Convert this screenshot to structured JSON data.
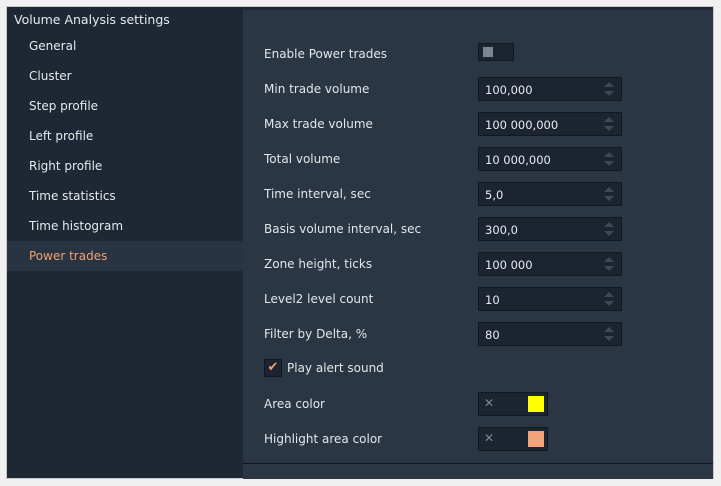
{
  "window": {
    "title": "Volume Analysis settings",
    "close_glyph": "✕"
  },
  "sidebar": {
    "items": [
      {
        "label": "General",
        "active": false
      },
      {
        "label": "Cluster",
        "active": false
      },
      {
        "label": "Step profile",
        "active": false
      },
      {
        "label": "Left profile",
        "active": false
      },
      {
        "label": "Right profile",
        "active": false
      },
      {
        "label": "Time statistics",
        "active": false
      },
      {
        "label": "Time histogram",
        "active": false
      },
      {
        "label": "Power trades",
        "active": true
      }
    ]
  },
  "form": {
    "enable_power_trades": {
      "label": "Enable Power trades",
      "enabled": false
    },
    "min_trade_volume": {
      "label": "Min trade volume",
      "value": "100,000"
    },
    "max_trade_volume": {
      "label": "Max trade volume",
      "value": "100 000,000"
    },
    "total_volume": {
      "label": "Total volume",
      "value": "10 000,000"
    },
    "time_interval": {
      "label": "Time interval, sec",
      "value": "5,0"
    },
    "basis_volume_interval": {
      "label": "Basis volume interval, sec",
      "value": "300,0"
    },
    "zone_height": {
      "label": "Zone height, ticks",
      "value": "100 000"
    },
    "level2_count": {
      "label": "Level2 level count",
      "value": "10"
    },
    "filter_by_delta": {
      "label": "Filter by Delta, %",
      "value": "80"
    },
    "play_alert_sound": {
      "label": "Play alert sound",
      "checked": true,
      "check_glyph": "✔"
    },
    "area_color": {
      "label": "Area color",
      "color": "#ffff00",
      "clear_glyph": "✕"
    },
    "highlight_area_color": {
      "label": "Highlight area color",
      "color": "#f4a47a",
      "clear_glyph": "✕"
    }
  },
  "colors": {
    "accent": "#f2a071",
    "window_bg": "#1e2834",
    "panel_bg": "#2a3644",
    "input_bg": "#1b2430"
  }
}
